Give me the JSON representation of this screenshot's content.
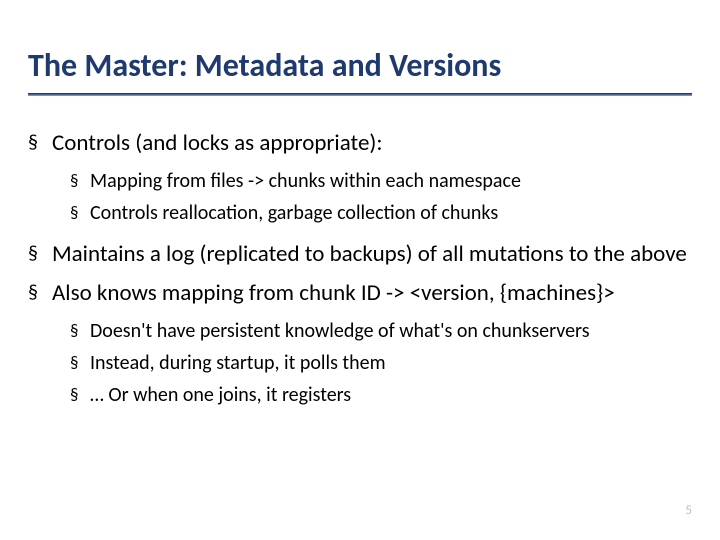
{
  "title": "The Master:  Metadata and Versions",
  "bullets": {
    "b1": "Controls (and locks as appropriate):",
    "b1_sub": [
      "Mapping from files -> chunks within each namespace",
      "Controls reallocation, garbage collection of chunks"
    ],
    "b2": "Maintains a log (replicated to backups) of all mutations to the above",
    "b3": "Also knows mapping from chunk ID -> <version, {machines}>",
    "b3_sub": [
      "Doesn't have persistent knowledge of what's on chunkservers",
      "Instead, during startup, it polls them",
      "… Or when one joins, it registers"
    ]
  },
  "page_number": "5"
}
